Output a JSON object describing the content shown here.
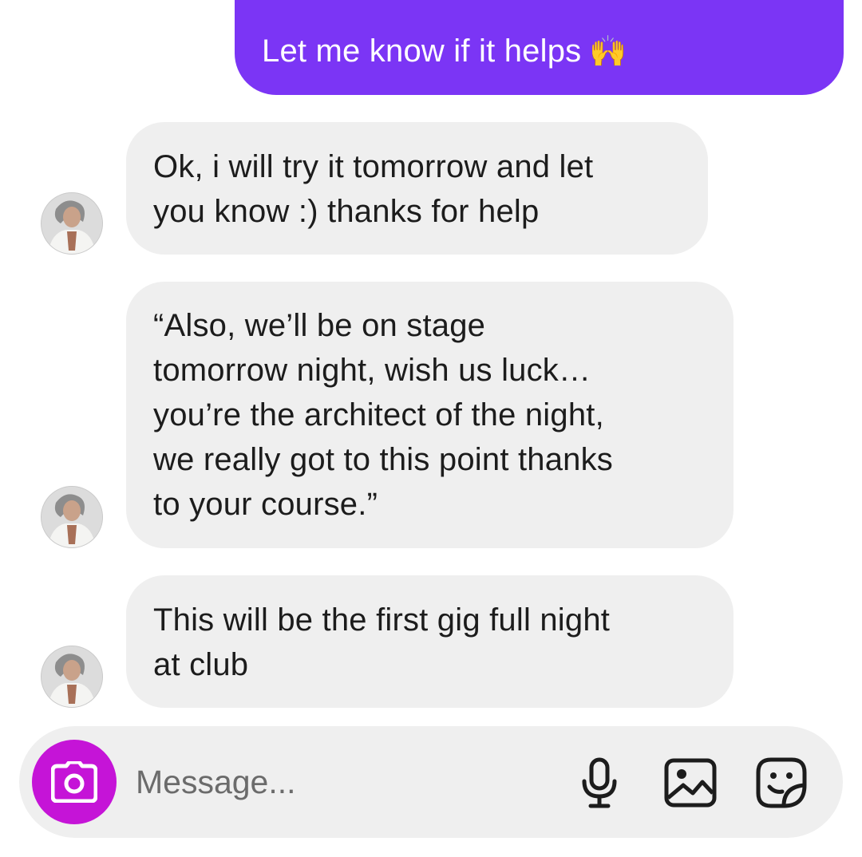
{
  "conversation": {
    "messages": [
      {
        "direction": "outgoing",
        "text": "Let me know if it helps",
        "emoji": "🙌"
      },
      {
        "direction": "incoming",
        "text": "Ok, i will try it tomorrow and let\nyou know :) thanks for help"
      },
      {
        "direction": "incoming",
        "text": "“Also, we’ll be on stage\ntomorrow night, wish us luck…\nyou’re the architect of the night,\nwe really got to this point thanks\nto your course.”"
      },
      {
        "direction": "incoming",
        "text": "This will be the first gig full night\nat club"
      }
    ]
  },
  "composer": {
    "placeholder": "Message...",
    "camera_icon": "camera-icon",
    "mic_icon": "microphone-icon",
    "gallery_icon": "image-gallery-icon",
    "sticker_icon": "sticker-icon"
  },
  "colors": {
    "outgoing_bubble": "#7b35f5",
    "incoming_bubble": "#efefef",
    "camera_button": "#c514d7",
    "composer_background": "#efefef"
  }
}
